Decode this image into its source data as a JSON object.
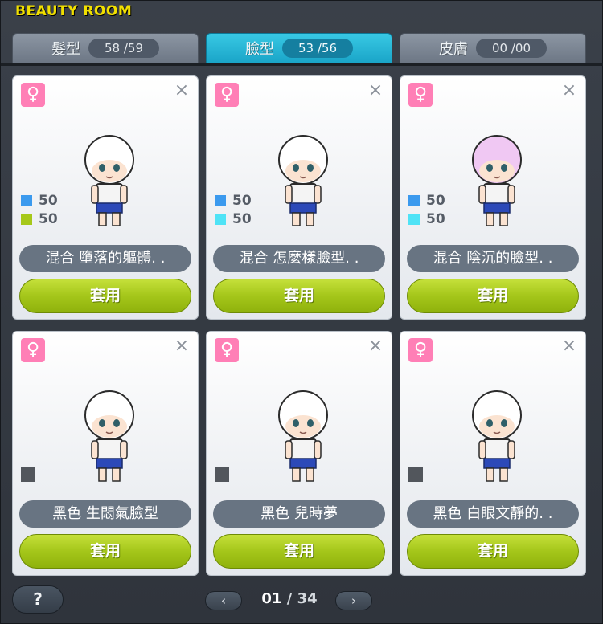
{
  "window": {
    "title": "BEAUTY ROOM"
  },
  "tabs": [
    {
      "label": "髮型",
      "count": "58 /59",
      "active": false
    },
    {
      "label": "臉型",
      "count": "53 /56",
      "active": true
    },
    {
      "label": "皮膚",
      "count": "00 /00",
      "active": false
    }
  ],
  "colors": {
    "title": "#f1e000",
    "active_tab": "#27b6d6",
    "apply_button": "#a4c61a",
    "gender_badge": "#ff7fb6",
    "name_bar": "#687482"
  },
  "cards": [
    {
      "gender_icon": "female-icon",
      "gender_symbol": "♀",
      "close_symbol": "×",
      "mix": [
        {
          "color": "#3b9aee",
          "value": "50"
        },
        {
          "color": "#a6c81a",
          "value": "50"
        }
      ],
      "name": "混合 墮落的軀體. .",
      "apply_label": "套用"
    },
    {
      "gender_icon": "female-icon",
      "gender_symbol": "♀",
      "close_symbol": "×",
      "mix": [
        {
          "color": "#3b9aee",
          "value": "50"
        },
        {
          "color": "#4fe3f6",
          "value": "50"
        }
      ],
      "name": "混合 怎麼樣臉型. .",
      "apply_label": "套用"
    },
    {
      "gender_icon": "female-icon",
      "gender_symbol": "♀",
      "close_symbol": "×",
      "mix": [
        {
          "color": "#3b9aee",
          "value": "50"
        },
        {
          "color": "#4fe3f6",
          "value": "50"
        }
      ],
      "name": "混合 陰沉的臉型. .",
      "apply_label": "套用"
    },
    {
      "gender_icon": "female-icon",
      "gender_symbol": "♀",
      "close_symbol": "×",
      "swatch_color": "#52565c",
      "name": "黑色 生悶氣臉型",
      "apply_label": "套用"
    },
    {
      "gender_icon": "female-icon",
      "gender_symbol": "♀",
      "close_symbol": "×",
      "swatch_color": "#52565c",
      "name": "黑色 兒時夢",
      "apply_label": "套用"
    },
    {
      "gender_icon": "female-icon",
      "gender_symbol": "♀",
      "close_symbol": "×",
      "swatch_color": "#52565c",
      "name": "黑色 白眼文靜的. .",
      "apply_label": "套用"
    }
  ],
  "footer": {
    "help_label": "?",
    "prev_label": "‹",
    "next_label": "›",
    "current_page": "01",
    "separator": "/",
    "total_pages": "34"
  }
}
